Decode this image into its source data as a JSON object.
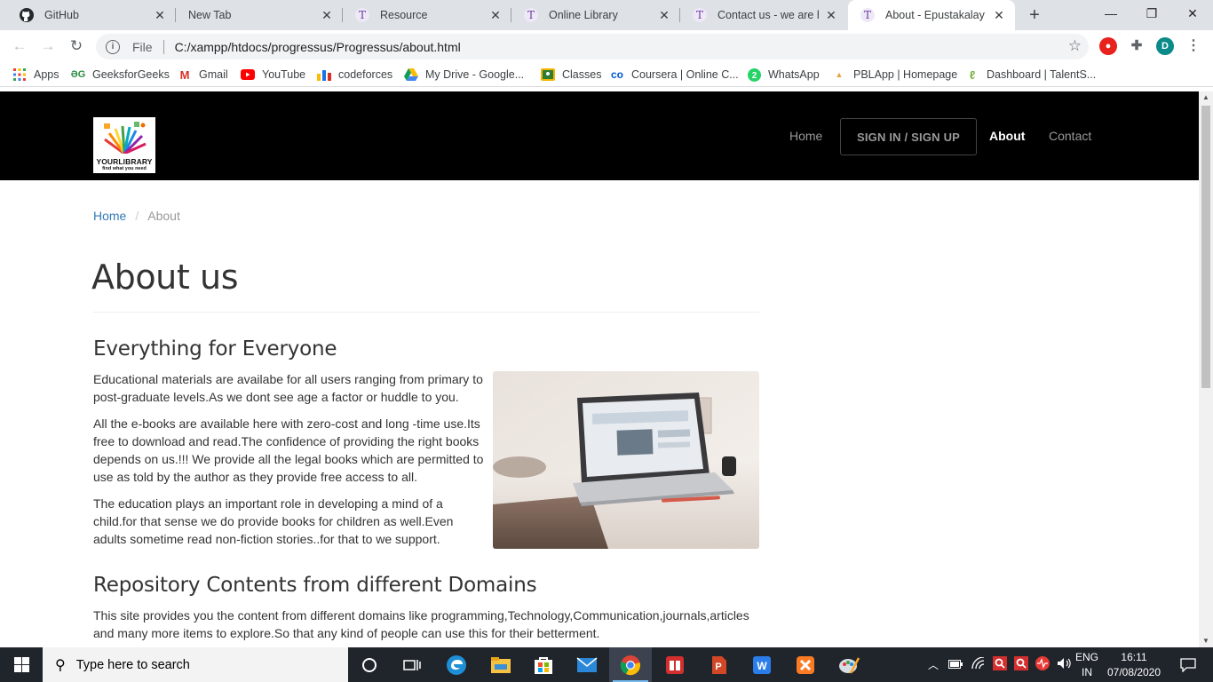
{
  "browser": {
    "tabs": [
      {
        "title": "GitHub",
        "icon": "github-icon"
      },
      {
        "title": "New Tab",
        "icon": "none"
      },
      {
        "title": "Resource",
        "icon": "T"
      },
      {
        "title": "Online Library",
        "icon": "T"
      },
      {
        "title": "Contact us - we are hap",
        "icon": "T"
      },
      {
        "title": "About - Epustakalay",
        "icon": "T"
      }
    ],
    "window_controls": {
      "minimize": "—",
      "restore": "❐",
      "close": "✕"
    },
    "address": {
      "scheme": "File",
      "url": "C:/xampp/htdocs/progressus/Progressus/about.html"
    },
    "profile_initial": "D",
    "bookmarks": [
      {
        "label": "Apps"
      },
      {
        "label": "GeeksforGeeks"
      },
      {
        "label": "Gmail"
      },
      {
        "label": "YouTube"
      },
      {
        "label": "codeforces"
      },
      {
        "label": "My Drive - Google..."
      },
      {
        "label": "Classes"
      },
      {
        "label": "Coursera | Online C..."
      },
      {
        "label": "WhatsApp"
      },
      {
        "label": "PBLApp | Homepage"
      },
      {
        "label": "Dashboard | TalentS..."
      }
    ]
  },
  "site": {
    "logo": {
      "name": "YOURLIBRARY",
      "tagline": "find what you need"
    },
    "nav": {
      "home": "Home",
      "signin": "SIGN IN / SIGN UP",
      "about": "About",
      "contact": "Contact"
    },
    "breadcrumb": {
      "home": "Home",
      "separator": "/",
      "current": "About"
    },
    "page_title": "About us",
    "sections": [
      {
        "heading": "Everything for Everyone",
        "paragraphs": [
          [
            "Educational materials are availabe for all users ranging from primary to",
            "post-graduate levels.As we dont see age a factor or huddle to you."
          ],
          [
            "All the e-books are available here with zero-cost and long -time use.Its",
            "free to download and read.The confidence of providing the right books",
            "depends on us.!!! We provide all the legal books which are permitted to",
            "use as told by the author as they provide free access to all."
          ],
          [
            "The education plays an important role in developing a mind of a",
            "child.for that sense we do provide books for children as well.Even",
            "adults sometime read non-fiction stories..for that to we support."
          ]
        ]
      },
      {
        "heading": "Repository Contents from different Domains",
        "paragraphs": [
          [
            "This site provides you the content from different domains like programming,Technology,Communication,journals,articles",
            "and many more items to explore.So that any kind of people can use this for their betterment."
          ]
        ]
      }
    ],
    "colors": {
      "navbar": "#000000",
      "link": "#337ab7",
      "text": "#333333"
    }
  },
  "taskbar": {
    "search_placeholder": "Type here to search",
    "language": [
      "ENG",
      "IN"
    ],
    "time": "16:11",
    "date": "07/08/2020"
  }
}
